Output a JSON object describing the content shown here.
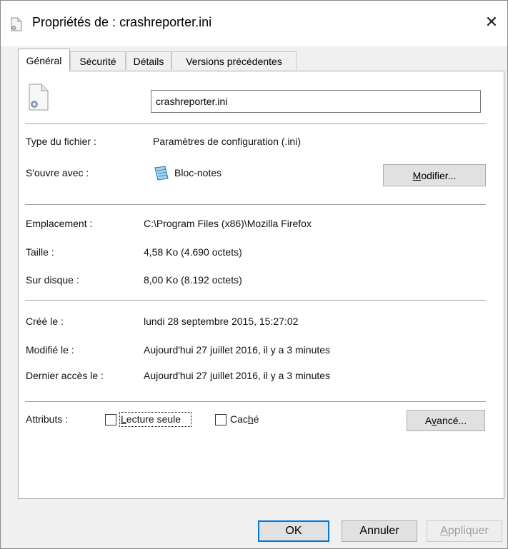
{
  "window": {
    "title": "Propriétés de : crashreporter.ini",
    "close_glyph": "✕"
  },
  "tabs": [
    {
      "label": "Général",
      "active": true
    },
    {
      "label": "Sécurité",
      "active": false
    },
    {
      "label": "Détails",
      "active": false
    },
    {
      "label": "Versions précédentes",
      "active": false
    }
  ],
  "general": {
    "file_name": "crashreporter.ini",
    "file_type_label": "Type du fichier :",
    "file_type_value": "Paramètres de configuration (.ini)",
    "opens_with_label": "S'ouvre avec :",
    "opens_with_app": "Bloc-notes",
    "change_button": {
      "accel": "M",
      "rest": "odifier..."
    },
    "location_label": "Emplacement :",
    "location_value": "C:\\Program Files (x86)\\Mozilla Firefox",
    "size_label": "Taille :",
    "size_value": "4,58 Ko (4.690 octets)",
    "size_on_disk_label": "Sur disque :",
    "size_on_disk_value": "8,00 Ko (8.192 octets)",
    "created_label": "Créé le :",
    "created_value": "lundi 28 septembre 2015, 15:27:02",
    "modified_label": "Modifié le :",
    "modified_value": "Aujourd'hui 27 juillet 2016, il y a 3 minutes",
    "accessed_label": "Dernier accès le :",
    "accessed_value": "Aujourd'hui 27 juillet 2016, il y a 3 minutes",
    "attributes_label": "Attributs :",
    "readonly": {
      "accel": "L",
      "rest": "ecture seule",
      "checked": false
    },
    "hidden": {
      "pre": "Cac",
      "accel": "h",
      "post": "é",
      "checked": false
    },
    "advanced_button": {
      "pre": "A",
      "accel": "v",
      "post": "ancé..."
    }
  },
  "footer": {
    "ok_label": "OK",
    "cancel_label": "Annuler",
    "apply_button": {
      "accel": "A",
      "rest": "ppliquer"
    }
  },
  "colors": {
    "accent": "#0078d7",
    "disabled_text": "#a0a0a0"
  }
}
